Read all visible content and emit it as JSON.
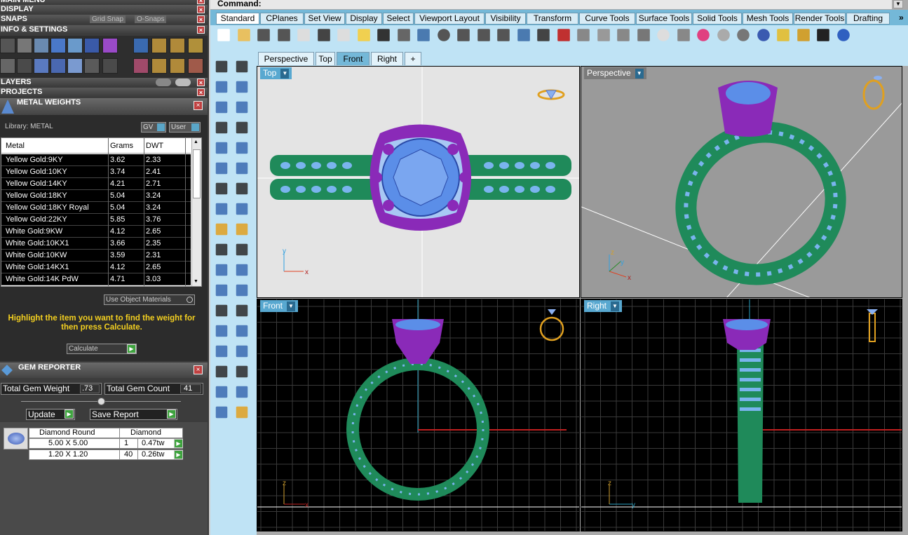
{
  "left_panel": {
    "headers": {
      "display": "DISPLAY",
      "snaps": "SNAPS",
      "info_settings": "INFO & SETTINGS",
      "layers": "LAYERS",
      "projects": "PROJECTS"
    },
    "snaps_options": {
      "grid_snap": "Grid Snap",
      "o_snaps": "O-Snaps"
    }
  },
  "metal_weights": {
    "title": "METAL WEIGHTS",
    "library_label": "Library: METAL",
    "gv_label": "GV",
    "user_label": "User",
    "columns": [
      "Metal",
      "Grams",
      "DWT"
    ],
    "rows": [
      {
        "metal": "Yellow Gold:9KY",
        "grams": "3.62",
        "dwt": "2.33"
      },
      {
        "metal": "Yellow Gold:10KY",
        "grams": "3.74",
        "dwt": "2.41"
      },
      {
        "metal": "Yellow Gold:14KY",
        "grams": "4.21",
        "dwt": "2.71"
      },
      {
        "metal": "Yellow Gold:18KY",
        "grams": "5.04",
        "dwt": "3.24"
      },
      {
        "metal": "Yellow Gold:18KY Royal",
        "grams": "5.04",
        "dwt": "3.24"
      },
      {
        "metal": "Yellow Gold:22KY",
        "grams": "5.85",
        "dwt": "3.76"
      },
      {
        "metal": "White Gold:9KW",
        "grams": "4.12",
        "dwt": "2.65"
      },
      {
        "metal": "White Gold:10KX1",
        "grams": "3.66",
        "dwt": "2.35"
      },
      {
        "metal": "White Gold:10KW",
        "grams": "3.59",
        "dwt": "2.31"
      },
      {
        "metal": "White Gold:14KX1",
        "grams": "4.12",
        "dwt": "2.65"
      },
      {
        "metal": "White Gold:14K PdW",
        "grams": "4.71",
        "dwt": "3.03"
      }
    ],
    "use_object_materials": "Use Object Materials",
    "instructions": "Highlight the item you want to find the weight for then press Calculate.",
    "calculate_label": "Calculate"
  },
  "gem_reporter": {
    "title": "GEM REPORTER",
    "total_gem_weight_label": "Total Gem Weight",
    "total_gem_weight_value": ".73",
    "total_gem_count_label": "Total Gem Count",
    "total_gem_count_value": "41",
    "update_label": "Update",
    "save_report_label": "Save Report",
    "gem_header": {
      "shape": "Diamond Round",
      "type": "Diamond"
    },
    "gems": [
      {
        "size": "5.00 X 5.00",
        "count": "1",
        "weight": "0.47tw"
      },
      {
        "size": "1.20 X 1.20",
        "count": "40",
        "weight": "0.26tw"
      }
    ]
  },
  "command_bar": {
    "label": "Command:"
  },
  "toolbar_tabs": [
    "Standard",
    "CPlanes",
    "Set View",
    "Display",
    "Select",
    "Viewport Layout",
    "Visibility",
    "Transform",
    "Curve Tools",
    "Surface Tools",
    "Solid Tools",
    "Mesh Tools",
    "Render Tools",
    "Drafting"
  ],
  "overflow_label": "»",
  "viewport_tabs": [
    "Perspective",
    "Top",
    "Front",
    "Right",
    "+"
  ],
  "viewports": {
    "top": "Top",
    "perspective": "Perspective",
    "front": "Front",
    "right": "Right"
  },
  "axes": {
    "x": "x",
    "y": "y",
    "z": "z"
  },
  "colors": {
    "metal_purple": "#8a2ab8",
    "band_green": "#1f8a5a",
    "stone_blue": "#5b8ee8",
    "accent_tab": "#74b8d8"
  }
}
